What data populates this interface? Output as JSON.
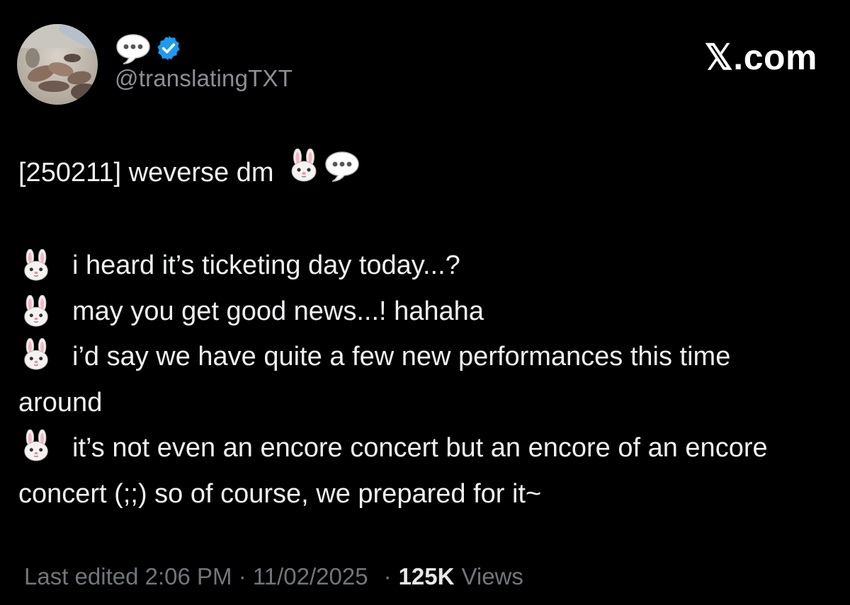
{
  "author": {
    "display_name_icon": "speech-bubble-emoji",
    "verified_icon": "verified-badge",
    "handle": "@translatingTXT"
  },
  "brand": {
    "site": "𝕏.com"
  },
  "post": {
    "title": "[250211] weverse dm",
    "title_emojis": [
      "rabbit-face-emoji",
      "speech-bubble-emoji"
    ],
    "lines": [
      "i heard it’s ticketing day today...?",
      "may you get good news...! hahaha",
      "i’d say we have quite a few new performances this time around",
      "it’s not even an encore concert but an encore of an encore concert (;;) so of course, we prepared for it~"
    ],
    "line_emoji": "rabbit-face-emoji"
  },
  "meta": {
    "edited": "Last edited 2:06 PM · 11/02/2025",
    "separator": "·",
    "views_count": "125K",
    "views_label": "Views"
  },
  "colors": {
    "background": "#000000",
    "text": "#eef0f1",
    "secondary": "#71767b",
    "verified": "#1d9bf0"
  }
}
